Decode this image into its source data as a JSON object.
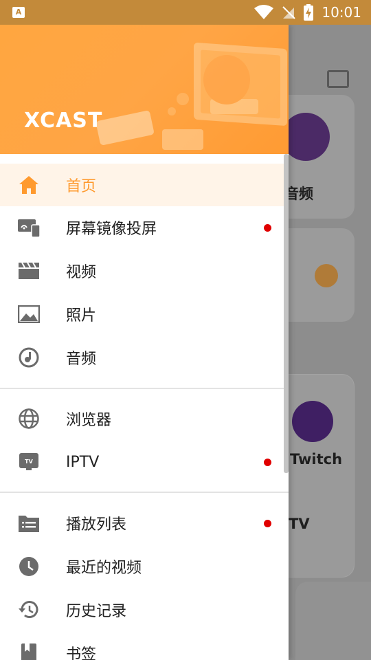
{
  "status_bar": {
    "app_badge": "A",
    "time": "10:01",
    "icons": [
      "wifi-icon",
      "no-signal-icon",
      "battery-charging-icon"
    ]
  },
  "background": {
    "audio_label": "音频",
    "twitch_label": "Twitch",
    "tv_label": "TV"
  },
  "drawer": {
    "brand": "XCAST",
    "sections": [
      {
        "items": [
          {
            "label": "首页",
            "icon": "home-icon",
            "active": true,
            "badge": false
          },
          {
            "label": "屏幕镜像投屏",
            "icon": "screen-mirror-icon",
            "active": false,
            "badge": true
          },
          {
            "label": "视频",
            "icon": "video-clapper-icon",
            "active": false,
            "badge": false
          },
          {
            "label": "照片",
            "icon": "photo-icon",
            "active": false,
            "badge": false
          },
          {
            "label": "音频",
            "icon": "audio-icon",
            "active": false,
            "badge": false
          }
        ]
      },
      {
        "items": [
          {
            "label": "浏览器",
            "icon": "globe-icon",
            "active": false,
            "badge": false
          },
          {
            "label": "IPTV",
            "icon": "tv-icon",
            "active": false,
            "badge": true
          }
        ]
      },
      {
        "items": [
          {
            "label": "播放列表",
            "icon": "playlist-icon",
            "active": false,
            "badge": true
          },
          {
            "label": "最近的视频",
            "icon": "clock-icon",
            "active": false,
            "badge": false
          },
          {
            "label": "历史记录",
            "icon": "history-icon",
            "active": false,
            "badge": false
          },
          {
            "label": "书签",
            "icon": "bookmark-icon",
            "active": false,
            "badge": false
          }
        ]
      }
    ]
  },
  "colors": {
    "accent": "#ff9a2e",
    "header": "#ffa640",
    "badge": "#e00000",
    "scrim_statusbar": "#c38a3a",
    "twitch": "#5b2c87"
  }
}
